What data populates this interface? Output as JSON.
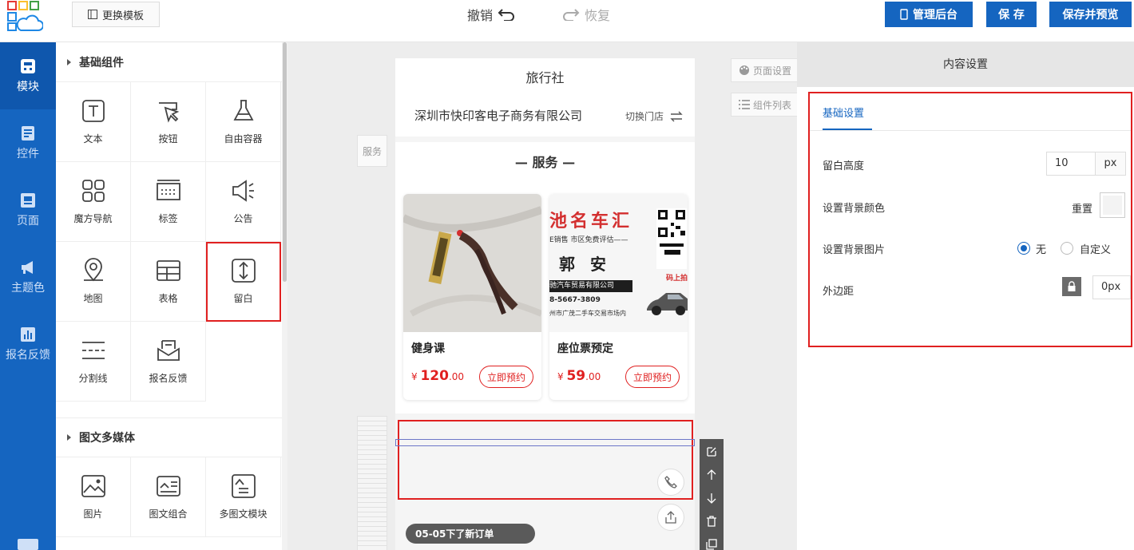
{
  "topbar": {
    "template_button": "更换模板",
    "undo": "撤销",
    "redo": "恢复",
    "admin_button": "管理后台",
    "save_button": "保 存",
    "save_preview_button": "保存并预览"
  },
  "leftnav": {
    "items": [
      {
        "label": "模块",
        "icon": "module-icon"
      },
      {
        "label": "控件",
        "icon": "control-icon"
      },
      {
        "label": "页面",
        "icon": "page-icon"
      },
      {
        "label": "主题色",
        "icon": "megaphone-icon"
      },
      {
        "label": "报名反馈",
        "icon": "chart-icon"
      }
    ],
    "active": "模块"
  },
  "panel": {
    "basic_title": "基础组件",
    "basic_items": [
      "文本",
      "按钮",
      "自由容器",
      "魔方导航",
      "标签",
      "公告",
      "地图",
      "表格",
      "留白",
      "分割线",
      "报名反馈"
    ],
    "selected": "留白",
    "media_title": "图文多媒体",
    "media_items": [
      "图片",
      "图文组合",
      "多图文模块"
    ]
  },
  "canvas": {
    "page_settings": "页面设置",
    "component_list": "组件列表",
    "side_tag": "服务",
    "phone": {
      "title": "旅行社",
      "store_name": "深圳市快印客电子商务有限公司",
      "switch_store": "切换门店",
      "service_title": "— 服务 —",
      "cards": [
        {
          "name": "健身课",
          "currency": "¥",
          "price_int": "120",
          "price_dec": ".00",
          "button": "立即预约"
        },
        {
          "name": "座位票预定",
          "currency": "¥",
          "price_int": "59",
          "price_dec": ".00",
          "button": "立即预约"
        }
      ],
      "card2_image_text": {
        "line1": "池名车汇",
        "line2": "E销售 市区免费评估——",
        "line3": "郭 安",
        "line4": "驰汽车贸易有限公司",
        "line5": "8-5667-3809",
        "line6": "州市广茂二手车交易市场内",
        "line7": "码上拍"
      },
      "order_notice": "05-05下了新订单"
    }
  },
  "rpanel": {
    "header": "内容设置",
    "tab": "基础设置",
    "height_label": "留白高度",
    "height_value": "10",
    "height_unit": "px",
    "bg_color_label": "设置背景颜色",
    "reset": "重置",
    "bg_color": "#f3f3f3",
    "bg_image_label": "设置背景图片",
    "bg_image_opt_none": "无",
    "bg_image_opt_custom": "自定义",
    "bg_image_selected": "无",
    "margin_label": "外边距",
    "margin_value": "0px"
  },
  "colors": {
    "brand": "#1565c0",
    "highlight": "#e02020",
    "price": "#e02020"
  }
}
